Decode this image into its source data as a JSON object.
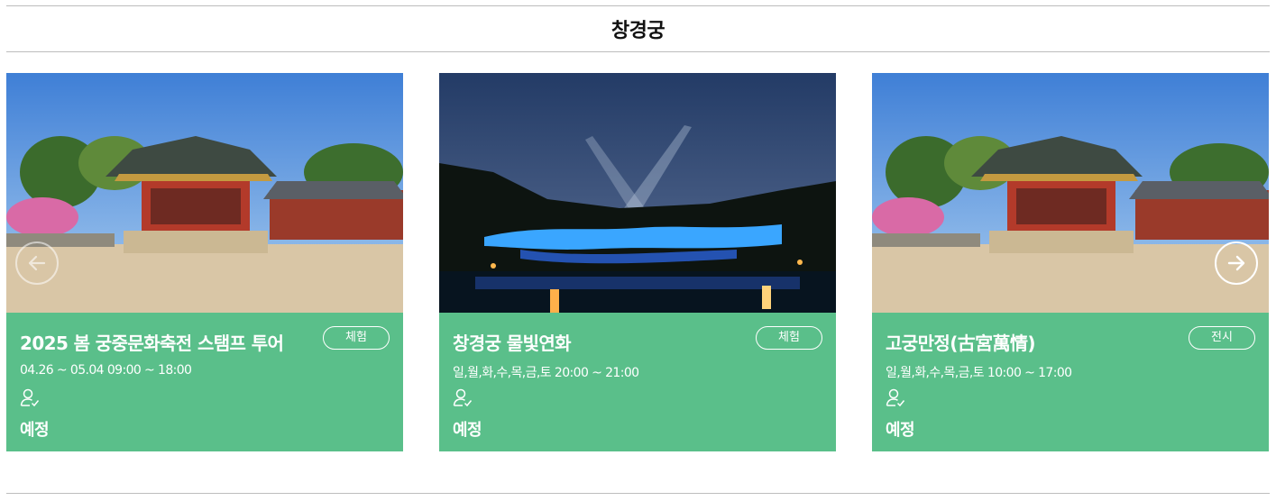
{
  "section": {
    "title": "창경궁"
  },
  "cards": [
    {
      "title": "2025 봄 궁중문화축전 스탬프 투어",
      "badge": "체험",
      "schedule": "04.26 ~ 05.04   09:00 ~ 18:00",
      "status": "예정",
      "image": "palace-pavilion-spring"
    },
    {
      "title": "창경궁 물빛연화",
      "badge": "체험",
      "schedule": "일,월,화,수,목,금,토   20:00 ~ 21:00",
      "status": "예정",
      "image": "night-dragon-light-show"
    },
    {
      "title": "고궁만정(古宮萬情)",
      "badge": "전시",
      "schedule": "일,월,화,수,목,금,토   10:00 ~ 17:00",
      "status": "예정",
      "image": "palace-pavilion-spring"
    }
  ],
  "icons": {
    "prev": "arrow-left-icon",
    "next": "arrow-right-icon",
    "user": "user-check-icon"
  },
  "colors": {
    "card_info_bg": "#5abf8a",
    "title_text": "#111111",
    "divider": "#bdbdbd"
  }
}
